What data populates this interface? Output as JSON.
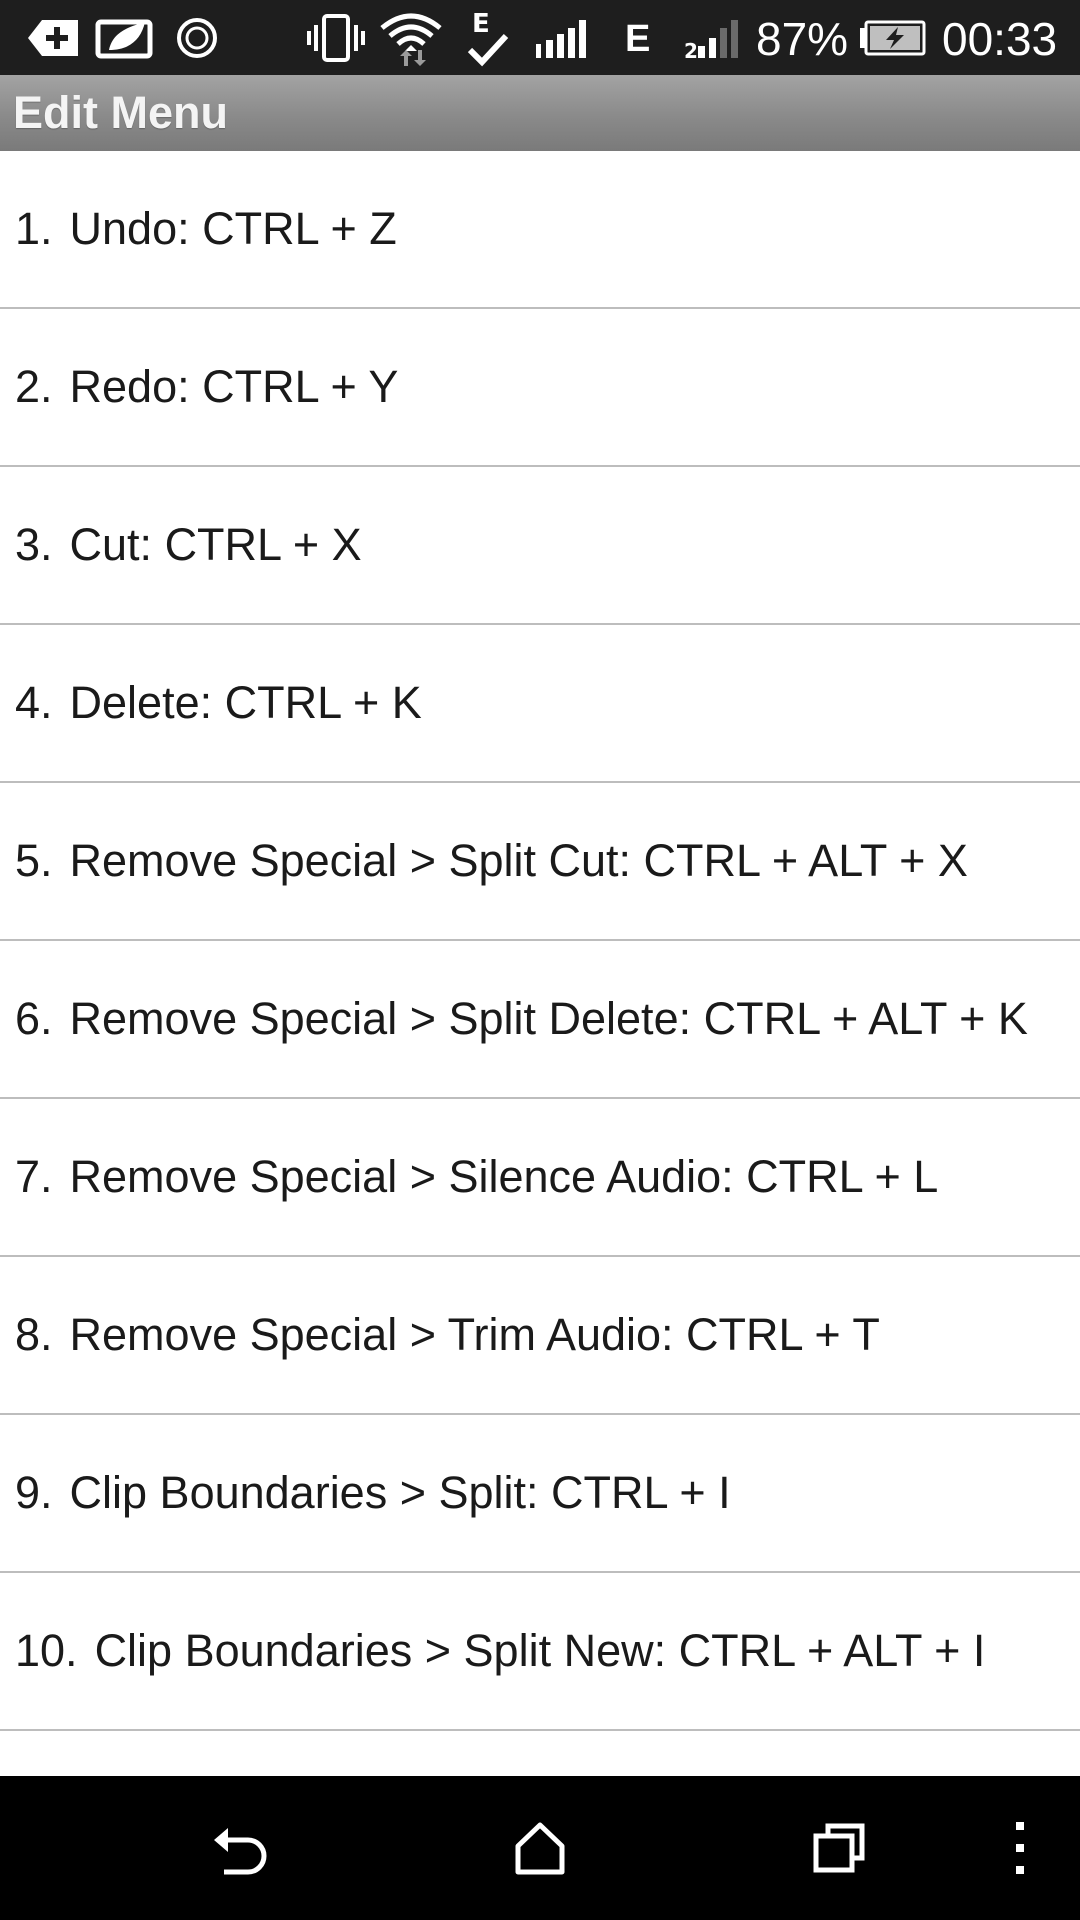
{
  "status_bar": {
    "battery_percent": "87%",
    "time": "00:33",
    "network_type_1": "E",
    "network_type_2": "E",
    "icons": [
      "add-notification-icon",
      "leaf-notification-icon",
      "circle-notification-icon",
      "vibrate-icon",
      "wifi-icon",
      "data-check-icon",
      "signal-icon",
      "signal-icon-2",
      "battery-charging-icon"
    ]
  },
  "header": {
    "title": "Edit Menu"
  },
  "list": {
    "items": [
      {
        "num": "1.",
        "text": "Undo: CTRL + Z"
      },
      {
        "num": "2.",
        "text": "Redo: CTRL + Y"
      },
      {
        "num": "3.",
        "text": "Cut: CTRL + X"
      },
      {
        "num": "4.",
        "text": "Delete: CTRL + K"
      },
      {
        "num": "5.",
        "text": "Remove Special > Split Cut: CTRL + ALT + X"
      },
      {
        "num": "6.",
        "text": "Remove Special > Split Delete: CTRL + ALT + K"
      },
      {
        "num": "7.",
        "text": "Remove Special > Silence Audio: CTRL + L"
      },
      {
        "num": "8.",
        "text": "Remove Special > Trim Audio: CTRL + T"
      },
      {
        "num": "9.",
        "text": "Clip Boundaries > Split: CTRL + I"
      },
      {
        "num": "10.",
        "text": "Clip Boundaries > Split New: CTRL + ALT + I"
      }
    ]
  },
  "nav_bar": {
    "buttons": [
      "back-icon",
      "home-icon",
      "recent-apps-icon",
      "overflow-menu-icon"
    ]
  },
  "colors": {
    "status_bar_bg": "#1e1e1e",
    "title_bar_bg": "#8a8a8a",
    "divider": "#bdbdbd",
    "text": "#1a1a1a",
    "nav_bar_bg": "#000000"
  }
}
